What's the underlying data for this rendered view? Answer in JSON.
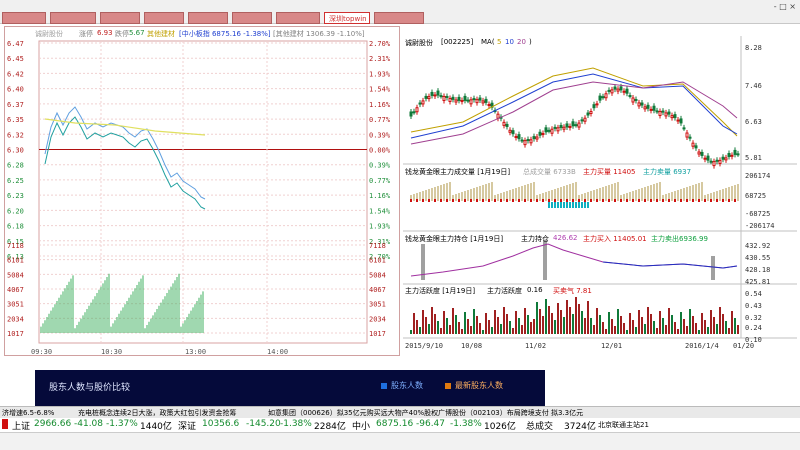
{
  "tabs": [
    {
      "label": ""
    },
    {
      "label": ""
    },
    {
      "label": ""
    },
    {
      "label": ""
    },
    {
      "label": ""
    },
    {
      "label": ""
    },
    {
      "label": ""
    },
    {
      "label": "深圳topwin"
    },
    {
      "label": ""
    }
  ],
  "window_controls": "- □ ×",
  "intraday": {
    "header_name": "诚尉股份",
    "header_limit_up_label": "涨停",
    "header_limit_up_value": "6.93",
    "header_limit_down_label": "跌停",
    "header_limit_down_value": "5.67",
    "header_right1": "其他建材",
    "header_index": "[中小板指 6875.16 -1.38%]",
    "header_right2": "[其他建材 1306.39 -1.10%]",
    "price_labels_left": [
      "6.47",
      "6.45",
      "6.42",
      "6.40",
      "6.37",
      "6.35",
      "6.32",
      "6.30",
      "6.28",
      "6.25",
      "6.23",
      "6.20",
      "6.18",
      "6.15",
      "6.13"
    ],
    "pct_labels_right": [
      "2.70%",
      "2.31%",
      "1.93%",
      "1.54%",
      "1.16%",
      "0.77%",
      "0.39%",
      "0.00%",
      "0.39%",
      "0.77%",
      "1.16%",
      "1.54%",
      "1.93%",
      "2.31%",
      "2.70%"
    ],
    "vol_labels_left": [
      "7118",
      "6101",
      "5084",
      "4067",
      "3051",
      "2034",
      "1017"
    ],
    "vol_labels_right": [
      "7118",
      "6101",
      "5084",
      "4067",
      "3051",
      "2034",
      "1017"
    ],
    "time_labels": [
      "09:30",
      "10:30",
      "13:00",
      "14:00"
    ]
  },
  "kline": {
    "header_name": "诚尉股份",
    "header_code": "[002225]",
    "header_ma": "MA(",
    "header_ma_values": [
      "5",
      "10",
      "20"
    ],
    "header_ma_close": ")",
    "price_labels": [
      "8.28",
      "7.46",
      "6.63",
      "5.81"
    ],
    "panel2_title": "钱龙黄金眼主力成交量 [1月19日]",
    "panel2_a": "总成交量 6733B",
    "panel2_b": "主力买量 11405",
    "panel2_c": "主力卖量 6937",
    "panel2_labels": [
      "206174",
      "68725",
      "-68725",
      "-206174"
    ],
    "panel3_title": "钱龙黄金眼主力持仓 [1月19日]",
    "panel3_a": "主力持仓",
    "panel3_a_val": "426.62",
    "panel3_b": "主力买入 11405.01",
    "panel3_c": "主力卖出6936.99",
    "panel3_labels": [
      "432.92",
      "430.55",
      "428.18",
      "425.81"
    ],
    "panel4_title": "主力活跃度 [1月19日]",
    "panel4_a": "主力活跃度",
    "panel4_a_val": "0.16",
    "panel4_b": "买卖气 7.81",
    "panel4_labels": [
      "0.54",
      "0.43",
      "0.32",
      "0.24",
      "0.10"
    ],
    "date_labels": [
      "2015/9/10",
      "10/08",
      "11/02",
      "12/01",
      "2016/1/4",
      "01/20"
    ]
  },
  "ratio_panel": {
    "title": "股东人数与股价比较",
    "legend1": "股东人数",
    "legend2": "最新股东人数",
    "color1": "#1e6fe0",
    "color2": "#e07a10"
  },
  "news_ticker": [
    "济增速6.5-6.8%",
    "充电桩概念连续2日大涨，政策大红包引发资金抢筹",
    "如意集团（000626）拟35亿元购买远大物产40%股权",
    "广博股份（002103）布局跨境支付 拟3.3亿元"
  ],
  "index_bar": {
    "sh_label": "上证",
    "sh_value": "2966.66",
    "sh_change": "-41.08",
    "sh_pct": "-1.37%",
    "sh_vol": "1440亿",
    "sz_label": "深证",
    "sz_value": "10356.6",
    "sz_change": "-145.20",
    "sz_pct": "-1.38%",
    "sz_vol": "2284亿",
    "zx_label": "中小",
    "zx_value": "6875.16",
    "zx_change": "-96.47",
    "zx_pct": "-1.38%",
    "zx_vol": "1026亿",
    "total_label": "总成交",
    "total_value": "3724亿",
    "site": "北京联通主站21"
  }
}
